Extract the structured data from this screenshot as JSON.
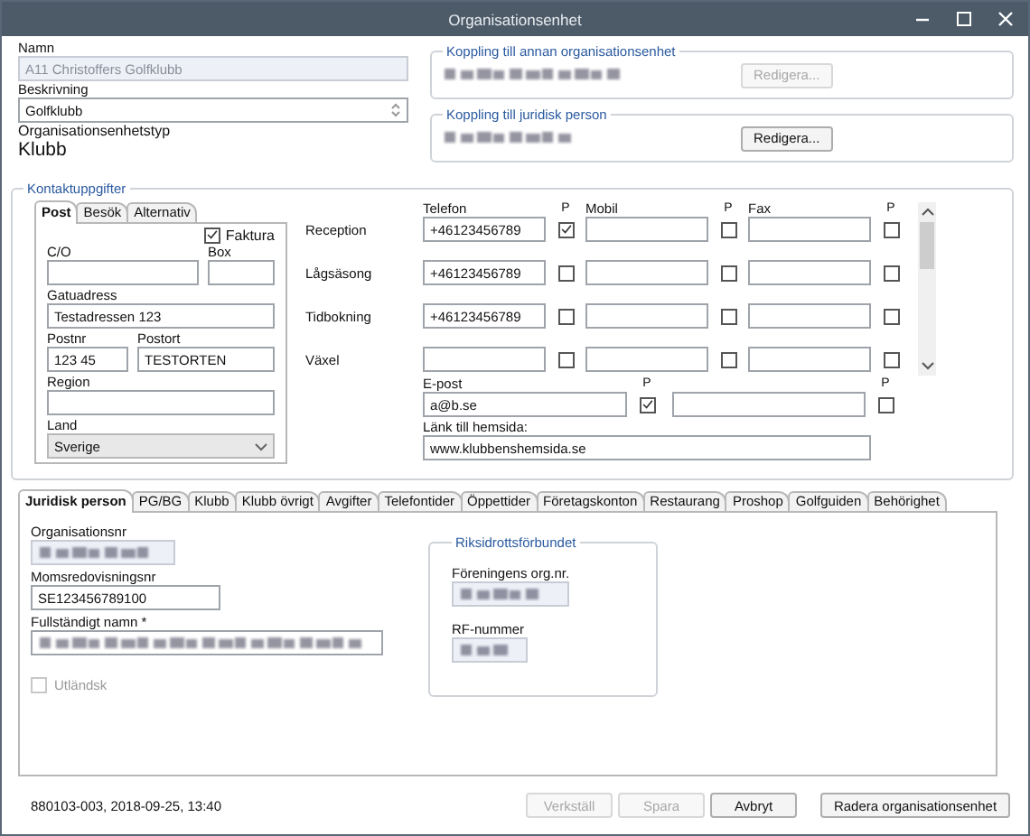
{
  "window": {
    "title": "Organisationsenhet"
  },
  "general": {
    "name": {
      "label": "Namn",
      "value": "A11 Christoffers Golfklubb",
      "disabled": true
    },
    "description": {
      "label": "Beskrivning",
      "value": "Golfklubb"
    },
    "type": {
      "label": "Organisationsenhetstyp",
      "value": "Klubb"
    }
  },
  "links": [
    {
      "title": "Koppling till annan organisationsenhet",
      "content_redacted": true,
      "button": "Redigera...",
      "button_disabled": true
    },
    {
      "title": "Koppling till juridisk person",
      "content_redacted": true,
      "button": "Redigera...",
      "button_disabled": false
    }
  ],
  "contact": {
    "title": "Kontaktuppgifter",
    "address_tabs": [
      {
        "label": "Post",
        "selected": true
      },
      {
        "label": "Besök",
        "selected": false
      },
      {
        "label": "Alternativ",
        "selected": false
      }
    ],
    "invoice": {
      "label": "Faktura",
      "checked": true
    },
    "address_rows": [
      [
        {
          "label": "C/O"
        },
        {
          "label": "Box"
        }
      ],
      [
        {
          "label": "Gatuadress",
          "value": "Testadressen 123"
        }
      ],
      [
        {
          "label": "Postnr",
          "value": "123 45"
        },
        {
          "label": "Postort",
          "value": "TESTORTEN"
        }
      ],
      [
        {
          "label": "Region"
        }
      ]
    ],
    "country": {
      "label": "Land",
      "value": "Sverige"
    },
    "phone_columns": [
      {
        "label": "Telefon",
        "p_label": "P"
      },
      {
        "label": "Mobil",
        "p_label": "P"
      },
      {
        "label": "Fax",
        "p_label": "P"
      }
    ],
    "phone_rows": [
      {
        "label": "Reception",
        "cells": [
          {
            "value": "+46123456789",
            "p": true
          },
          {
            "p": false
          },
          {
            "p": false
          }
        ]
      },
      {
        "label": "Lågsäsong",
        "cells": [
          {
            "value": "+46123456789",
            "p": false
          },
          {
            "p": false
          },
          {
            "p": false
          }
        ]
      },
      {
        "label": "Tidbokning",
        "cells": [
          {
            "value": "+46123456789",
            "p": false
          },
          {
            "p": false
          },
          {
            "p": false
          }
        ]
      },
      {
        "label": "Växel",
        "cells": [
          {
            "p": false
          },
          {
            "p": false
          },
          {
            "p": false
          }
        ]
      }
    ],
    "email": {
      "label": "E-post",
      "entries": [
        {
          "value": "a@b.se",
          "p_label": "P",
          "p": true
        },
        {
          "p_label": "P",
          "p": false
        }
      ]
    },
    "website": {
      "label": "Länk till hemsida:",
      "value": "www.klubbenshemsida.se"
    }
  },
  "tabs": [
    {
      "label": "Juridisk person",
      "selected": true
    },
    {
      "label": "PG/BG",
      "selected": false
    },
    {
      "label": "Klubb",
      "selected": false
    },
    {
      "label": "Klubb övrigt",
      "selected": false
    },
    {
      "label": "Avgifter",
      "selected": false
    },
    {
      "label": "Telefontider",
      "selected": false
    },
    {
      "label": "Öppettider",
      "selected": false
    },
    {
      "label": "Företagskonton",
      "selected": false
    },
    {
      "label": "Restaurang",
      "selected": false
    },
    {
      "label": "Proshop",
      "selected": false
    },
    {
      "label": "Golfguiden",
      "selected": false
    },
    {
      "label": "Behörighet",
      "selected": false
    }
  ],
  "legal": {
    "fields": [
      {
        "label": "Organisationsnr",
        "redacted": true,
        "disabled": true
      },
      {
        "label": "Momsredovisningsnr",
        "value": "SE123456789100"
      },
      {
        "label": "Fullständigt namn *",
        "redacted": true
      }
    ],
    "foreign": {
      "label": "Utländsk",
      "checked": false,
      "disabled": true
    },
    "rf": {
      "title": "Riksidrottsförbundet",
      "fields": [
        {
          "label": "Föreningens org.nr.",
          "redacted": true,
          "disabled": true
        },
        {
          "label": "RF-nummer",
          "redacted": true,
          "disabled": true
        }
      ]
    }
  },
  "status": "880103-003, 2018-09-25, 13:40",
  "buttons": [
    {
      "label": "Verkställ",
      "disabled": true
    },
    {
      "label": "Spara",
      "disabled": true
    },
    {
      "label": "Avbryt",
      "disabled": false
    },
    {
      "label": "Radera organisationsenhet",
      "disabled": false
    }
  ]
}
